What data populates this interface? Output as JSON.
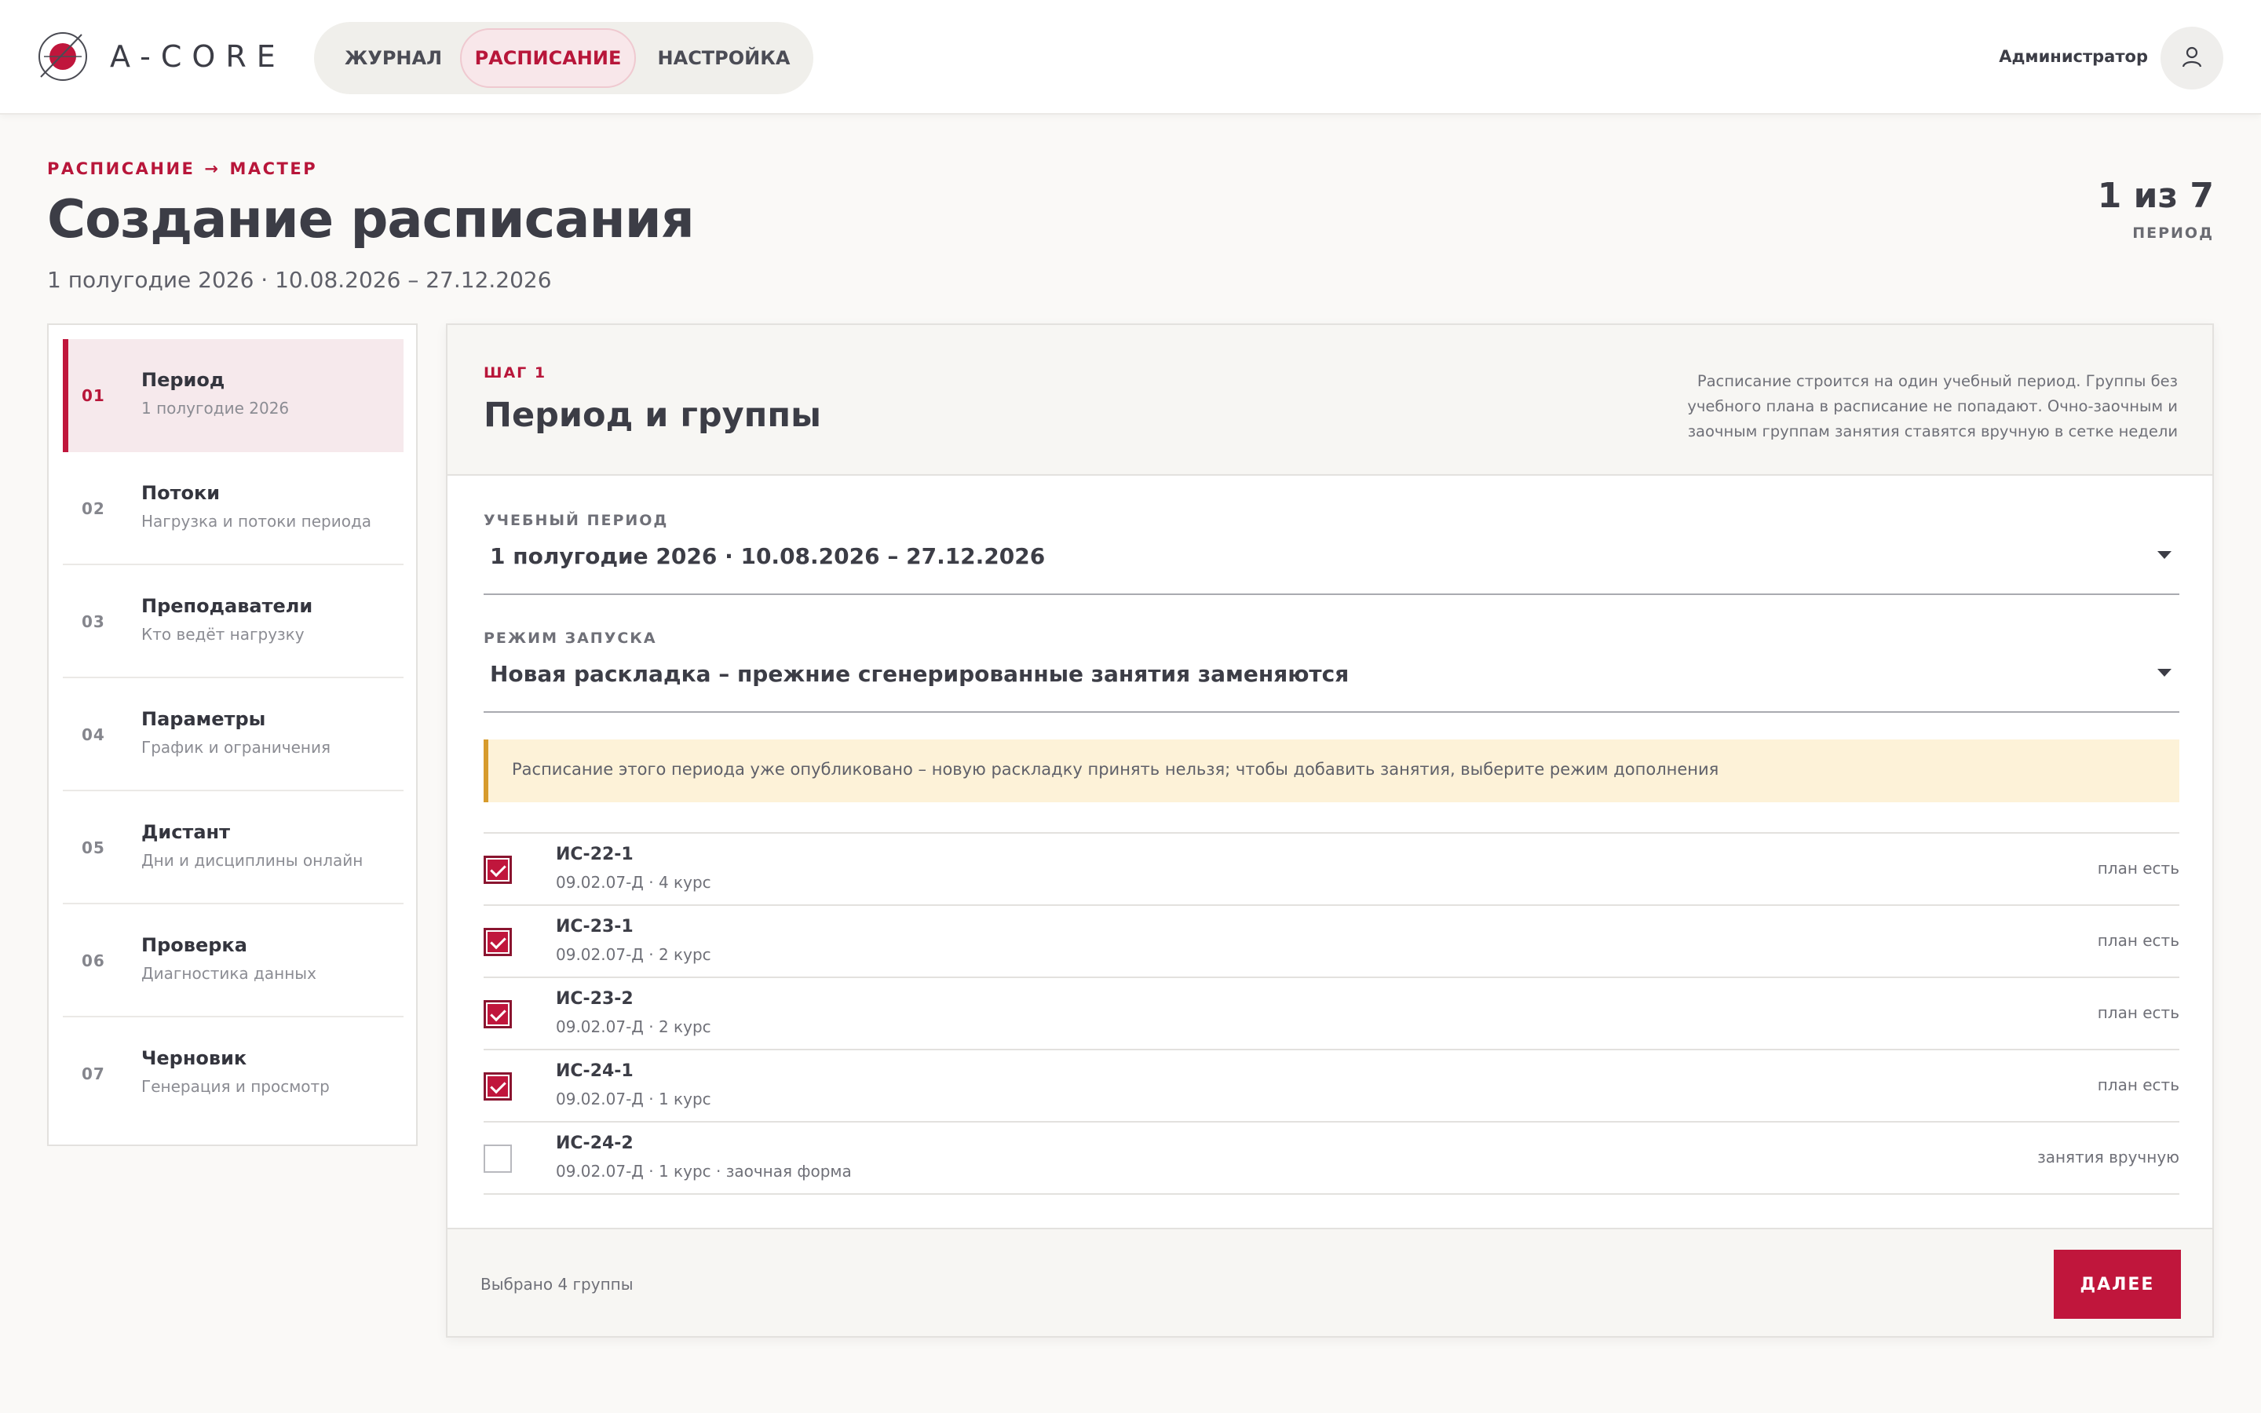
{
  "header": {
    "brand": "A-CORE",
    "nav": [
      {
        "label": "ЖУРНАЛ",
        "active": false
      },
      {
        "label": "РАСПИСАНИЕ",
        "active": true
      },
      {
        "label": "НАСТРОЙКА",
        "active": false
      }
    ],
    "user": {
      "name": "Администратор",
      "icon": "user-icon"
    }
  },
  "page": {
    "breadcrumb": [
      "РАСПИСАНИЕ",
      "МАСТЕР"
    ],
    "breadcrumb_sep": "→",
    "title": "Создание расписания",
    "subtitle": "1 полугодие 2026 · 10.08.2026 – 27.12.2026",
    "progress": {
      "value": "1 из 7",
      "label": "ПЕРИОД"
    }
  },
  "steps": [
    {
      "num": "01",
      "title": "Период",
      "desc": "1 полугодие 2026",
      "active": true
    },
    {
      "num": "02",
      "title": "Потоки",
      "desc": "Нагрузка и потоки периода",
      "active": false
    },
    {
      "num": "03",
      "title": "Преподаватели",
      "desc": "Кто ведёт нагрузку",
      "active": false
    },
    {
      "num": "04",
      "title": "Параметры",
      "desc": "График и ограничения",
      "active": false
    },
    {
      "num": "05",
      "title": "Дистант",
      "desc": "Дни и дисциплины онлайн",
      "active": false
    },
    {
      "num": "06",
      "title": "Проверка",
      "desc": "Диагностика данных",
      "active": false
    },
    {
      "num": "07",
      "title": "Черновик",
      "desc": "Генерация и просмотр",
      "active": false
    }
  ],
  "card": {
    "kicker": "ШАГ 1",
    "title": "Период и группы",
    "note": "Расписание строится на один учебный период. Группы без учебного плана в расписание не попадают. Очно-заочным и заочным группам занятия ставятся вручную в сетке недели",
    "period_field": {
      "label": "УЧЕБНЫЙ ПЕРИОД",
      "value": "1 полугодие 2026 · 10.08.2026 – 27.12.2026"
    },
    "mode_field": {
      "label": "РЕЖИМ ЗАПУСКА",
      "value": "Новая раскладка – прежние сгенерированные занятия заменяются"
    },
    "alert": "Расписание этого периода уже опубликовано – новую раскладку принять нельзя; чтобы добавить занятия, выберите режим дополнения",
    "groups": [
      {
        "name": "ИС-22-1",
        "meta": "09.02.07-Д · 4 курс",
        "status": "план есть",
        "checked": true
      },
      {
        "name": "ИС-23-1",
        "meta": "09.02.07-Д · 2 курс",
        "status": "план есть",
        "checked": true
      },
      {
        "name": "ИС-23-2",
        "meta": "09.02.07-Д · 2 курс",
        "status": "план есть",
        "checked": true
      },
      {
        "name": "ИС-24-1",
        "meta": "09.02.07-Д · 1 курс",
        "status": "план есть",
        "checked": true
      },
      {
        "name": "ИС-24-2",
        "meta": "09.02.07-Д · 1 курс · заочная форма",
        "status": "занятия вручную",
        "checked": false
      }
    ],
    "footer": {
      "selected_text": "Выбрано 4 группы",
      "next_label": "ДАЛЕЕ"
    }
  },
  "colors": {
    "accent": "#c0163c",
    "alert_bg": "#fdf2d8",
    "alert_border": "#d79b2c"
  }
}
